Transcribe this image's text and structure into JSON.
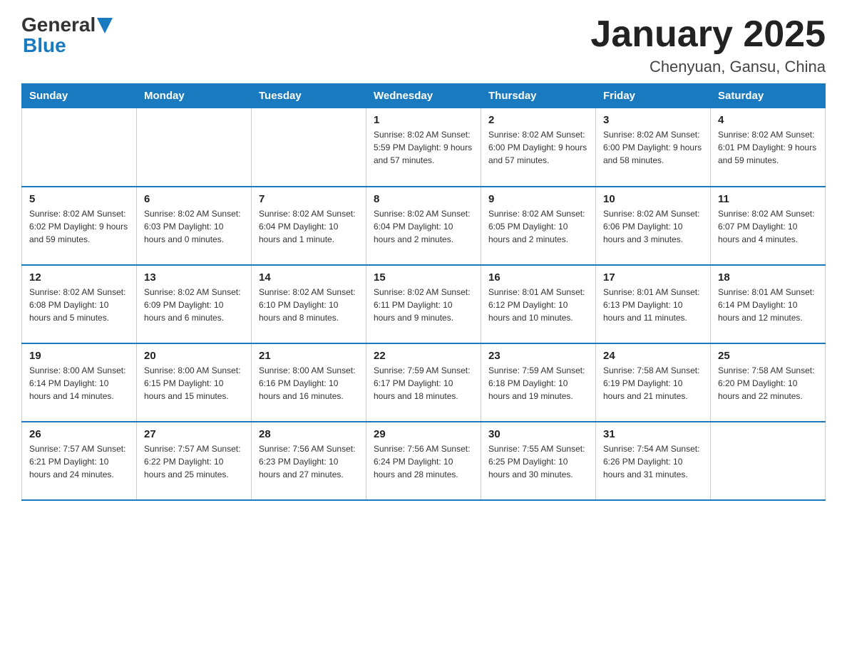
{
  "header": {
    "logo_general": "General",
    "logo_blue": "Blue",
    "title": "January 2025",
    "subtitle": "Chenyuan, Gansu, China"
  },
  "days_of_week": [
    "Sunday",
    "Monday",
    "Tuesday",
    "Wednesday",
    "Thursday",
    "Friday",
    "Saturday"
  ],
  "weeks": [
    [
      {
        "day": "",
        "info": ""
      },
      {
        "day": "",
        "info": ""
      },
      {
        "day": "",
        "info": ""
      },
      {
        "day": "1",
        "info": "Sunrise: 8:02 AM\nSunset: 5:59 PM\nDaylight: 9 hours\nand 57 minutes."
      },
      {
        "day": "2",
        "info": "Sunrise: 8:02 AM\nSunset: 6:00 PM\nDaylight: 9 hours\nand 57 minutes."
      },
      {
        "day": "3",
        "info": "Sunrise: 8:02 AM\nSunset: 6:00 PM\nDaylight: 9 hours\nand 58 minutes."
      },
      {
        "day": "4",
        "info": "Sunrise: 8:02 AM\nSunset: 6:01 PM\nDaylight: 9 hours\nand 59 minutes."
      }
    ],
    [
      {
        "day": "5",
        "info": "Sunrise: 8:02 AM\nSunset: 6:02 PM\nDaylight: 9 hours\nand 59 minutes."
      },
      {
        "day": "6",
        "info": "Sunrise: 8:02 AM\nSunset: 6:03 PM\nDaylight: 10 hours\nand 0 minutes."
      },
      {
        "day": "7",
        "info": "Sunrise: 8:02 AM\nSunset: 6:04 PM\nDaylight: 10 hours\nand 1 minute."
      },
      {
        "day": "8",
        "info": "Sunrise: 8:02 AM\nSunset: 6:04 PM\nDaylight: 10 hours\nand 2 minutes."
      },
      {
        "day": "9",
        "info": "Sunrise: 8:02 AM\nSunset: 6:05 PM\nDaylight: 10 hours\nand 2 minutes."
      },
      {
        "day": "10",
        "info": "Sunrise: 8:02 AM\nSunset: 6:06 PM\nDaylight: 10 hours\nand 3 minutes."
      },
      {
        "day": "11",
        "info": "Sunrise: 8:02 AM\nSunset: 6:07 PM\nDaylight: 10 hours\nand 4 minutes."
      }
    ],
    [
      {
        "day": "12",
        "info": "Sunrise: 8:02 AM\nSunset: 6:08 PM\nDaylight: 10 hours\nand 5 minutes."
      },
      {
        "day": "13",
        "info": "Sunrise: 8:02 AM\nSunset: 6:09 PM\nDaylight: 10 hours\nand 6 minutes."
      },
      {
        "day": "14",
        "info": "Sunrise: 8:02 AM\nSunset: 6:10 PM\nDaylight: 10 hours\nand 8 minutes."
      },
      {
        "day": "15",
        "info": "Sunrise: 8:02 AM\nSunset: 6:11 PM\nDaylight: 10 hours\nand 9 minutes."
      },
      {
        "day": "16",
        "info": "Sunrise: 8:01 AM\nSunset: 6:12 PM\nDaylight: 10 hours\nand 10 minutes."
      },
      {
        "day": "17",
        "info": "Sunrise: 8:01 AM\nSunset: 6:13 PM\nDaylight: 10 hours\nand 11 minutes."
      },
      {
        "day": "18",
        "info": "Sunrise: 8:01 AM\nSunset: 6:14 PM\nDaylight: 10 hours\nand 12 minutes."
      }
    ],
    [
      {
        "day": "19",
        "info": "Sunrise: 8:00 AM\nSunset: 6:14 PM\nDaylight: 10 hours\nand 14 minutes."
      },
      {
        "day": "20",
        "info": "Sunrise: 8:00 AM\nSunset: 6:15 PM\nDaylight: 10 hours\nand 15 minutes."
      },
      {
        "day": "21",
        "info": "Sunrise: 8:00 AM\nSunset: 6:16 PM\nDaylight: 10 hours\nand 16 minutes."
      },
      {
        "day": "22",
        "info": "Sunrise: 7:59 AM\nSunset: 6:17 PM\nDaylight: 10 hours\nand 18 minutes."
      },
      {
        "day": "23",
        "info": "Sunrise: 7:59 AM\nSunset: 6:18 PM\nDaylight: 10 hours\nand 19 minutes."
      },
      {
        "day": "24",
        "info": "Sunrise: 7:58 AM\nSunset: 6:19 PM\nDaylight: 10 hours\nand 21 minutes."
      },
      {
        "day": "25",
        "info": "Sunrise: 7:58 AM\nSunset: 6:20 PM\nDaylight: 10 hours\nand 22 minutes."
      }
    ],
    [
      {
        "day": "26",
        "info": "Sunrise: 7:57 AM\nSunset: 6:21 PM\nDaylight: 10 hours\nand 24 minutes."
      },
      {
        "day": "27",
        "info": "Sunrise: 7:57 AM\nSunset: 6:22 PM\nDaylight: 10 hours\nand 25 minutes."
      },
      {
        "day": "28",
        "info": "Sunrise: 7:56 AM\nSunset: 6:23 PM\nDaylight: 10 hours\nand 27 minutes."
      },
      {
        "day": "29",
        "info": "Sunrise: 7:56 AM\nSunset: 6:24 PM\nDaylight: 10 hours\nand 28 minutes."
      },
      {
        "day": "30",
        "info": "Sunrise: 7:55 AM\nSunset: 6:25 PM\nDaylight: 10 hours\nand 30 minutes."
      },
      {
        "day": "31",
        "info": "Sunrise: 7:54 AM\nSunset: 6:26 PM\nDaylight: 10 hours\nand 31 minutes."
      },
      {
        "day": "",
        "info": ""
      }
    ]
  ]
}
